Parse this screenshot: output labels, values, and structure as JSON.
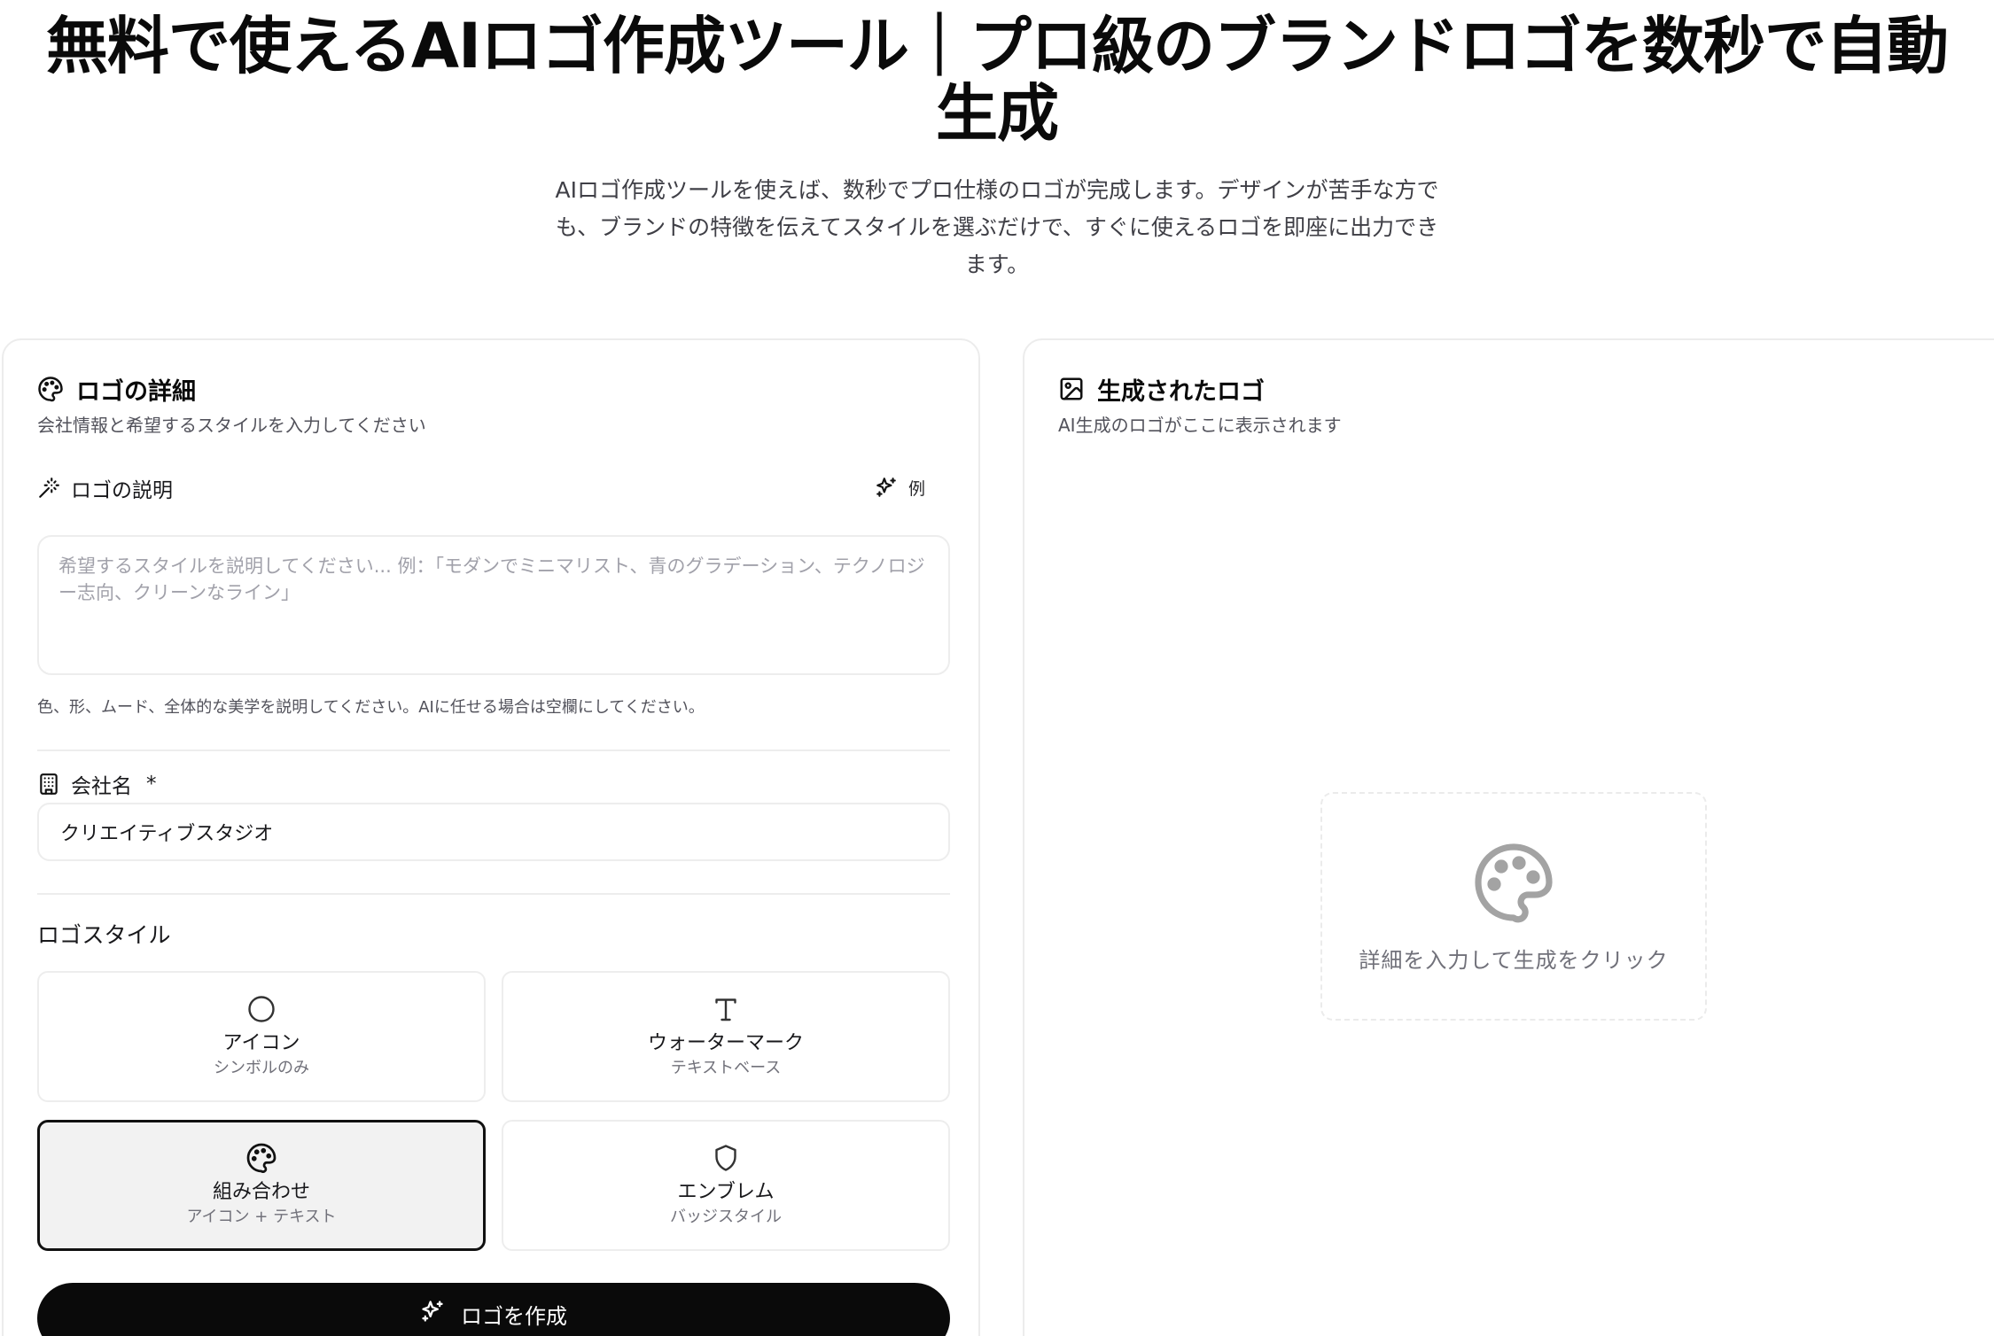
{
  "hero": {
    "title_line1": "無料で使えるAIロゴ作成ツール｜プロ級のブランドロゴを数秒で自動",
    "title_line2": "生成",
    "subtitle": "AIロゴ作成ツールを使えば、数秒でプロ仕様のロゴが完成します。デザインが苦手な方でも、ブランドの特徴を伝えてスタイルを選ぶだけで、すぐに使えるロゴを即座に出力できます。"
  },
  "details_card": {
    "icon": "palette-icon",
    "title": "ロゴの詳細",
    "description": "会社情報と希望するスタイルを入力してください",
    "logo_description": {
      "icon": "magic-wand-icon",
      "label": "ロゴの説明",
      "example_label": "例",
      "placeholder": "希望するスタイルを説明してください... 例：「モダンでミニマリスト、青のグラデーション、テクノロジー志向、クリーンなライン」",
      "help": "色、形、ムード、全体的な美学を説明してください。AIに任せる場合は空欄にしてください。"
    },
    "company": {
      "icon": "building-icon",
      "label": "会社名",
      "required_mark": "*",
      "value": "クリエイティブスタジオ"
    },
    "style": {
      "label": "ロゴスタイル",
      "options": [
        {
          "name": "アイコン",
          "sub": "シンボルのみ",
          "icon": "circle-icon",
          "selected": false
        },
        {
          "name": "ウォーターマーク",
          "sub": "テキストベース",
          "icon": "text-icon",
          "selected": false
        },
        {
          "name": "組み合わせ",
          "sub": "アイコン + テキスト",
          "icon": "palette-icon",
          "selected": true
        },
        {
          "name": "エンブレム",
          "sub": "バッジスタイル",
          "icon": "shield-icon",
          "selected": false
        }
      ]
    },
    "create_button": "ロゴを作成"
  },
  "result_card": {
    "icon": "image-icon",
    "title": "生成されたロゴ",
    "description": "AI生成のロゴがここに表示されます",
    "empty_text": "詳細を入力して生成をクリック"
  }
}
